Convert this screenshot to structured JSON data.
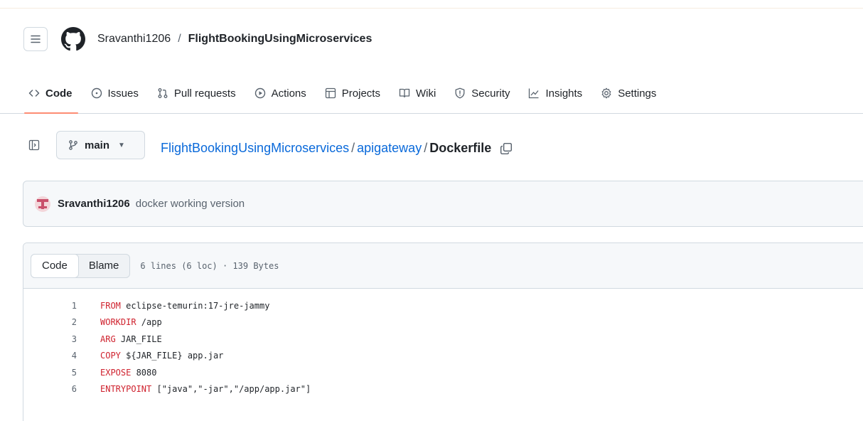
{
  "header": {
    "owner": "Sravanthi1206",
    "separator": "/",
    "repo": "FlightBookingUsingMicroservices"
  },
  "tabs": [
    {
      "label": "Code",
      "icon": "code-icon"
    },
    {
      "label": "Issues",
      "icon": "issue-icon"
    },
    {
      "label": "Pull requests",
      "icon": "pull-request-icon"
    },
    {
      "label": "Actions",
      "icon": "play-icon"
    },
    {
      "label": "Projects",
      "icon": "table-icon"
    },
    {
      "label": "Wiki",
      "icon": "book-icon"
    },
    {
      "label": "Security",
      "icon": "shield-icon"
    },
    {
      "label": "Insights",
      "icon": "graph-icon"
    },
    {
      "label": "Settings",
      "icon": "gear-icon"
    }
  ],
  "branch": {
    "name": "main"
  },
  "path": {
    "repo": "FlightBookingUsingMicroservices",
    "sep1": "/",
    "dir": "apigateway",
    "sep2": "/",
    "file": "Dockerfile"
  },
  "commit": {
    "author": "Sravanthi1206",
    "message": "docker working version"
  },
  "viewer": {
    "code_label": "Code",
    "blame_label": "Blame",
    "file_info": "6 lines (6 loc) · 139 Bytes"
  },
  "code_lines": [
    {
      "num": "1",
      "keyword": "FROM",
      "rest": " eclipse-temurin:17-jre-jammy"
    },
    {
      "num": "2",
      "keyword": "WORKDIR",
      "rest": " /app"
    },
    {
      "num": "3",
      "keyword": "ARG",
      "rest": " JAR_FILE"
    },
    {
      "num": "4",
      "keyword": "COPY",
      "rest": " ${JAR_FILE} app.jar"
    },
    {
      "num": "5",
      "keyword": "EXPOSE",
      "rest": " 8080"
    },
    {
      "num": "6",
      "keyword": "ENTRYPOINT",
      "rest": " [\"java\",\"-jar\",\"/app/app.jar\"]"
    }
  ],
  "colors": {
    "link": "#0969da",
    "keyword": "#cf222e",
    "tab_underline": "#fd8c73"
  }
}
